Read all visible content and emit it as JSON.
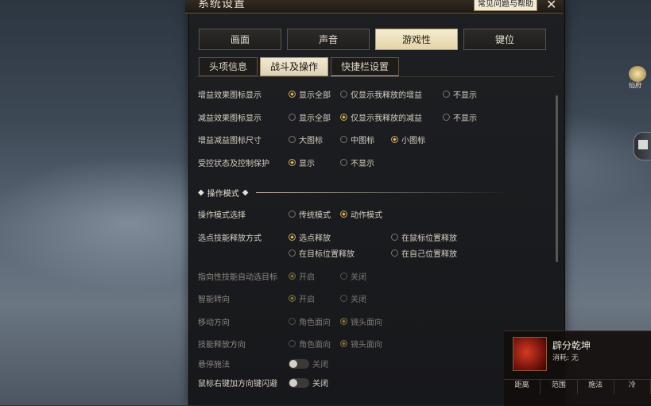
{
  "window": {
    "title": "系统设置",
    "help_label": "常见问题与帮助",
    "close_glyph": "✕"
  },
  "tabs": [
    "画面",
    "声音",
    "游戏性",
    "键位"
  ],
  "subtabs": [
    "头项信息",
    "战斗及操作",
    "快捷栏设置"
  ],
  "settings": [
    {
      "label": "增益效果图标显示",
      "options": [
        "显示全部",
        "仅显示我释放的增益",
        "不显示"
      ],
      "selected": 0
    },
    {
      "label": "减益效果图标显示",
      "options": [
        "显示全部",
        "仅显示我释放的减益",
        "不显示"
      ],
      "selected": 1
    },
    {
      "label": "增益减益图标尺寸",
      "options": [
        "大图标",
        "中图标",
        "小图标"
      ],
      "selected": 2
    },
    {
      "label": "受控状态及控制保护",
      "options": [
        "显示",
        "不显示"
      ],
      "selected": 0
    }
  ],
  "section_title": "操作模式",
  "operation": [
    {
      "label": "操作模式选择",
      "options": [
        "传统模式",
        "动作模式"
      ],
      "selected": 1
    },
    {
      "label": "选点技能释放方式",
      "options": [
        "选点释放",
        "在鼠标位置释放",
        "在目标位置释放",
        "在自己位置释放"
      ],
      "selected": 0
    },
    {
      "label": "指向性技能自动选目标",
      "options": [
        "开启",
        "关闭"
      ],
      "selected": 0,
      "disabled": true
    },
    {
      "label": "智能转向",
      "options": [
        "开启",
        "关闭"
      ],
      "selected": 0,
      "disabled": true
    },
    {
      "label": "移动方向",
      "options": [
        "角色面向",
        "镜头面向"
      ],
      "selected": 1,
      "disabled": true
    },
    {
      "label": "技能释放方向",
      "options": [
        "角色面向",
        "镜头面向"
      ],
      "selected": 1,
      "disabled": true
    }
  ],
  "toggles": [
    {
      "label": "悬停施法",
      "state": "关闭",
      "disabled": true
    },
    {
      "label": "鼠标右键加方向键闪避",
      "state": "关闭"
    }
  ],
  "skill": {
    "name": "辟分乾坤",
    "cost": "消耗: 无",
    "stats": [
      "距离",
      "范围",
      "施法",
      "冷"
    ]
  },
  "side": {
    "label": "仙府"
  },
  "colors": {
    "accent": "#c9a45a",
    "active_tab": "#f2e9cc",
    "panel": "#1b1c1f"
  }
}
